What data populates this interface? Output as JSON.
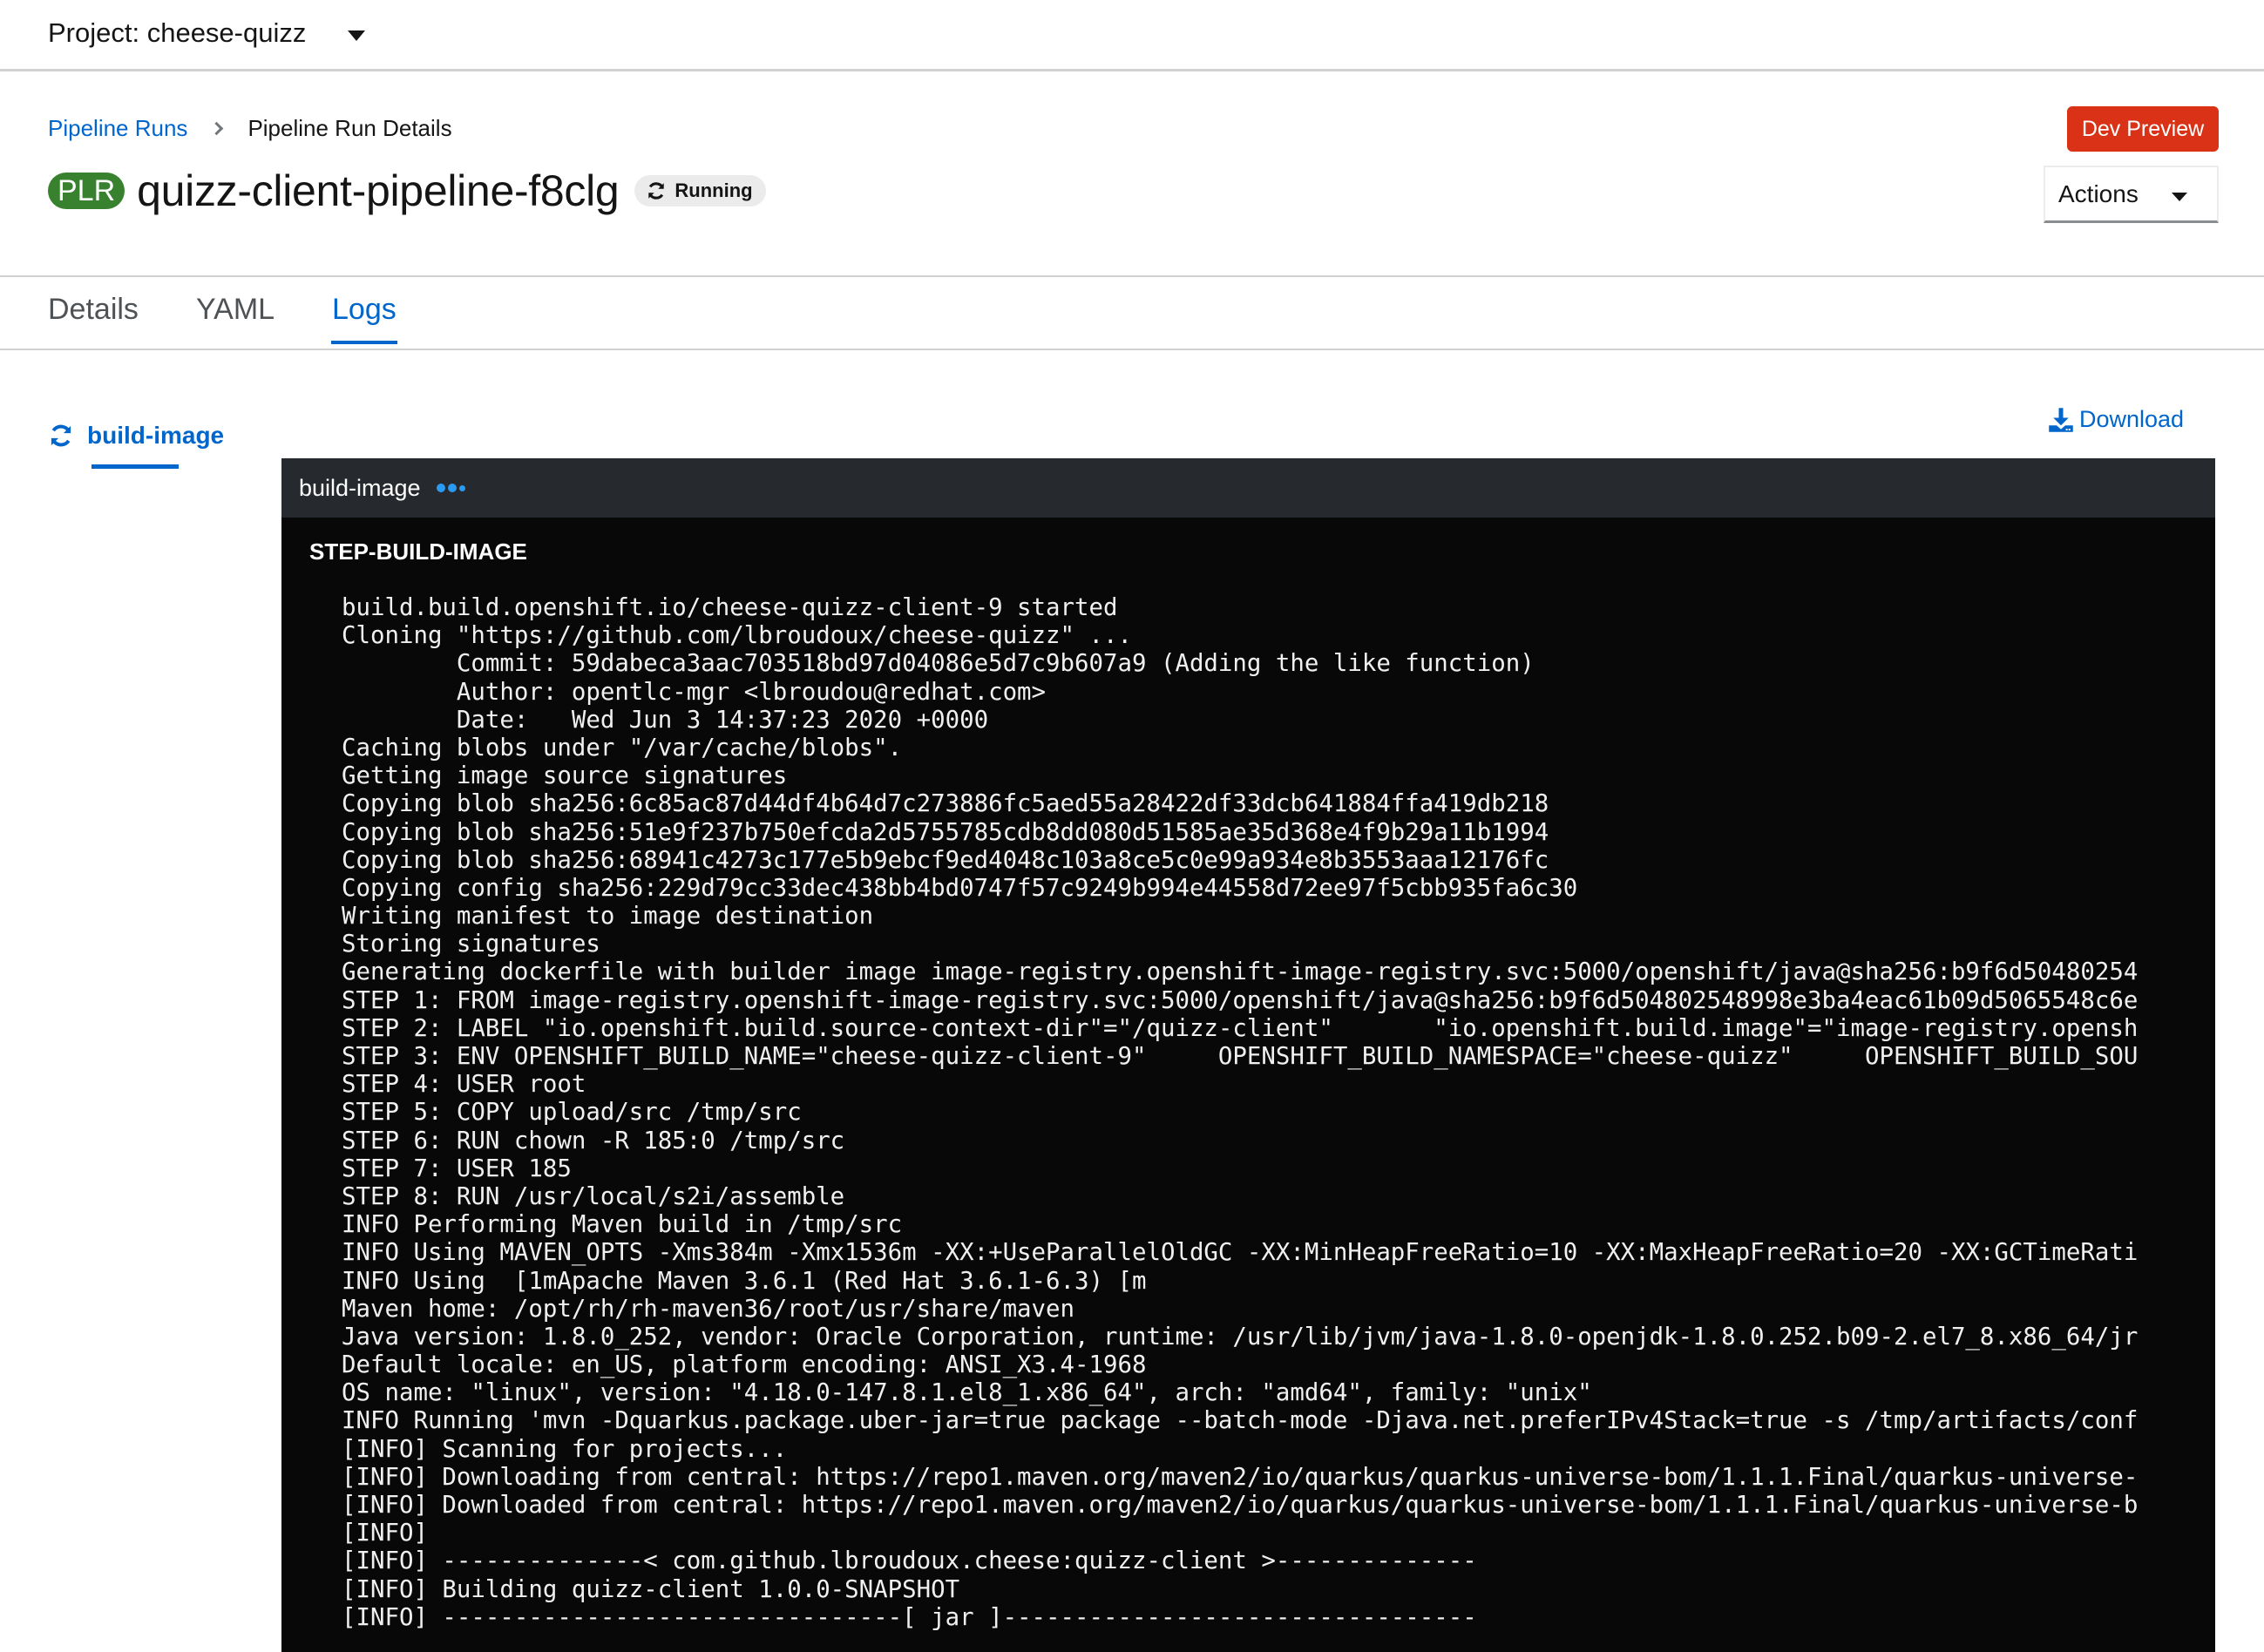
{
  "project": {
    "label": "Project: cheese-quizz"
  },
  "breadcrumb": {
    "parent": "Pipeline Runs",
    "current": "Pipeline Run Details"
  },
  "header": {
    "badge": "PLR",
    "title": "quizz-client-pipeline-f8clg",
    "status": "Running",
    "dev_preview": "Dev Preview",
    "actions": "Actions"
  },
  "tabs": [
    {
      "label": "Details",
      "active": false
    },
    {
      "label": "YAML",
      "active": false
    },
    {
      "label": "Logs",
      "active": true
    }
  ],
  "tasks": [
    {
      "name": "build-image",
      "status": "running"
    }
  ],
  "download": {
    "label": "Download"
  },
  "colors": {
    "accent": "#0066cc",
    "plr_badge": "#38812f",
    "dev_preview": "#d93216",
    "log_header": "#26292d",
    "log_bg": "#080808",
    "progress_dots": "#2b9af3"
  },
  "log": {
    "task_name": "build-image",
    "step_title": "STEP-BUILD-IMAGE",
    "lines": [
      "build.build.openshift.io/cheese-quizz-client-9 started",
      "Cloning \"https://github.com/lbroudoux/cheese-quizz\" ...",
      "        Commit: 59dabeca3aac703518bd97d04086e5d7c9b607a9 (Adding the like function)",
      "        Author: opentlc-mgr <lbroudou@redhat.com>",
      "        Date:   Wed Jun 3 14:37:23 2020 +0000",
      "Caching blobs under \"/var/cache/blobs\".",
      "Getting image source signatures",
      "Copying blob sha256:6c85ac87d44df4b64d7c273886fc5aed55a28422df33dcb641884ffa419db218",
      "Copying blob sha256:51e9f237b750efcda2d5755785cdb8dd080d51585ae35d368e4f9b29a11b1994",
      "Copying blob sha256:68941c4273c177e5b9ebcf9ed4048c103a8ce5c0e99a934e8b3553aaa12176fc",
      "Copying config sha256:229d79cc33dec438bb4bd0747f57c9249b994e44558d72ee97f5cbb935fa6c30",
      "Writing manifest to image destination",
      "Storing signatures",
      "Generating dockerfile with builder image image-registry.openshift-image-registry.svc:5000/openshift/java@sha256:b9f6d50480254",
      "STEP 1: FROM image-registry.openshift-image-registry.svc:5000/openshift/java@sha256:b9f6d504802548998e3ba4eac61b09d5065548c6e",
      "STEP 2: LABEL \"io.openshift.build.source-context-dir\"=\"/quizz-client\"       \"io.openshift.build.image\"=\"image-registry.opensh",
      "STEP 3: ENV OPENSHIFT_BUILD_NAME=\"cheese-quizz-client-9\"     OPENSHIFT_BUILD_NAMESPACE=\"cheese-quizz\"     OPENSHIFT_BUILD_SOU",
      "STEP 4: USER root",
      "STEP 5: COPY upload/src /tmp/src",
      "STEP 6: RUN chown -R 185:0 /tmp/src",
      "STEP 7: USER 185",
      "STEP 8: RUN /usr/local/s2i/assemble",
      "INFO Performing Maven build in /tmp/src",
      "INFO Using MAVEN_OPTS -Xms384m -Xmx1536m -XX:+UseParallelOldGC -XX:MinHeapFreeRatio=10 -XX:MaxHeapFreeRatio=20 -XX:GCTimeRati",
      "INFO Using  [1mApache Maven 3.6.1 (Red Hat 3.6.1-6.3) [m",
      "Maven home: /opt/rh/rh-maven36/root/usr/share/maven",
      "Java version: 1.8.0_252, vendor: Oracle Corporation, runtime: /usr/lib/jvm/java-1.8.0-openjdk-1.8.0.252.b09-2.el7_8.x86_64/jr",
      "Default locale: en_US, platform encoding: ANSI_X3.4-1968",
      "OS name: \"linux\", version: \"4.18.0-147.8.1.el8_1.x86_64\", arch: \"amd64\", family: \"unix\"",
      "INFO Running 'mvn -Dquarkus.package.uber-jar=true package --batch-mode -Djava.net.preferIPv4Stack=true -s /tmp/artifacts/conf",
      "[INFO] Scanning for projects...",
      "[INFO] Downloading from central: https://repo1.maven.org/maven2/io/quarkus/quarkus-universe-bom/1.1.1.Final/quarkus-universe-",
      "[INFO] Downloaded from central: https://repo1.maven.org/maven2/io/quarkus/quarkus-universe-bom/1.1.1.Final/quarkus-universe-b",
      "[INFO]",
      "[INFO] --------------< com.github.lbroudoux.cheese:quizz-client >--------------",
      "[INFO] Building quizz-client 1.0.0-SNAPSHOT",
      "[INFO] --------------------------------[ jar ]---------------------------------"
    ]
  }
}
